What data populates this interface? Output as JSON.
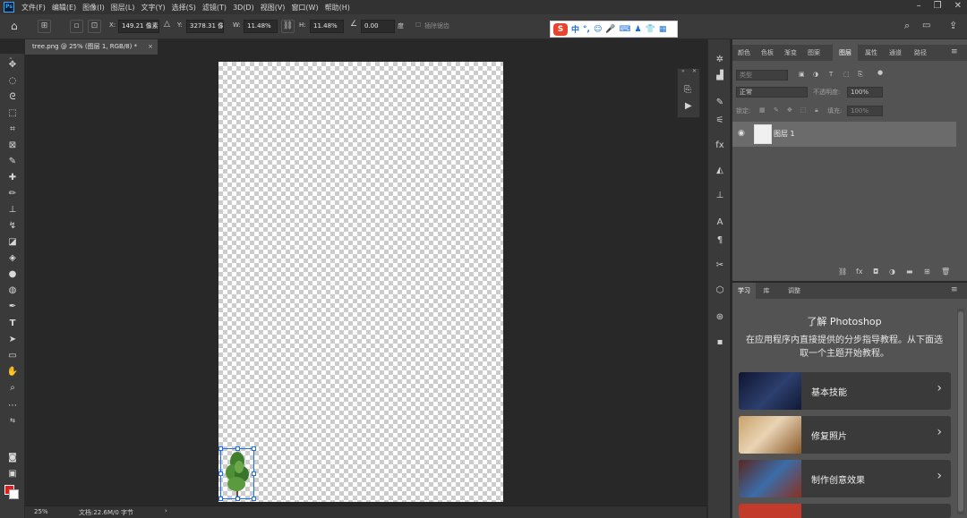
{
  "menubar": {
    "items": [
      "文件(F)",
      "编辑(E)",
      "图像(I)",
      "图层(L)",
      "文字(Y)",
      "选择(S)",
      "滤镜(T)",
      "3D(D)",
      "视图(V)",
      "窗口(W)",
      "帮助(H)"
    ],
    "logo": "Ps"
  },
  "options": {
    "x_label": "X:",
    "x_value": "149.21 像素",
    "y_label": "Y:",
    "y_value": "3278.31 像",
    "w_label": "W:",
    "w_value": "11.48%",
    "h_label": "H:",
    "h_value": "11.48%",
    "angle_value": "0.00",
    "angle_unit": "度",
    "interp_label": "插除锯齿"
  },
  "ime": {
    "logo": "S",
    "glyphs": [
      "中",
      "°,",
      "☺",
      "🎤",
      "⌨",
      "♟",
      "👕",
      "▦"
    ]
  },
  "document_tab": {
    "title": "tree.png @ 25% (图层 1, RGB/8) *",
    "close": "×"
  },
  "status": {
    "zoom": "25%",
    "doc_info": "文档:22.6M/0 字节",
    "arrow": "›"
  },
  "layers_panel": {
    "tabs": [
      "颜色",
      "色板",
      "渐变",
      "图案",
      "图层",
      "属性",
      "通道",
      "路径"
    ],
    "active_tab": "图层",
    "filter_placeholder": "类型",
    "blend_mode": "正常",
    "opacity_label": "不透明度:",
    "opacity_value": "100%",
    "lock_label": "锁定:",
    "fill_label": "填充:",
    "fill_value": "100%",
    "layer_name": "图层 1"
  },
  "learn_panel": {
    "tabs": [
      "学习",
      "库",
      "调整"
    ],
    "active_tab": "学习",
    "title": "了解 Photoshop",
    "description": "在应用程序内直接提供的分步指导教程。从下面选取一个主题开始教程。",
    "cards": [
      {
        "label": "基本技能",
        "thumb_color": "#1f2a4a"
      },
      {
        "label": "修复照片",
        "thumb_color": "#8b6b3a"
      },
      {
        "label": "制作创意效果",
        "thumb_color": "#6a2f2a"
      }
    ]
  },
  "colors": {
    "foreground": "#e51c1c",
    "background": "#ffffff",
    "selection": "#1e6ff1"
  }
}
